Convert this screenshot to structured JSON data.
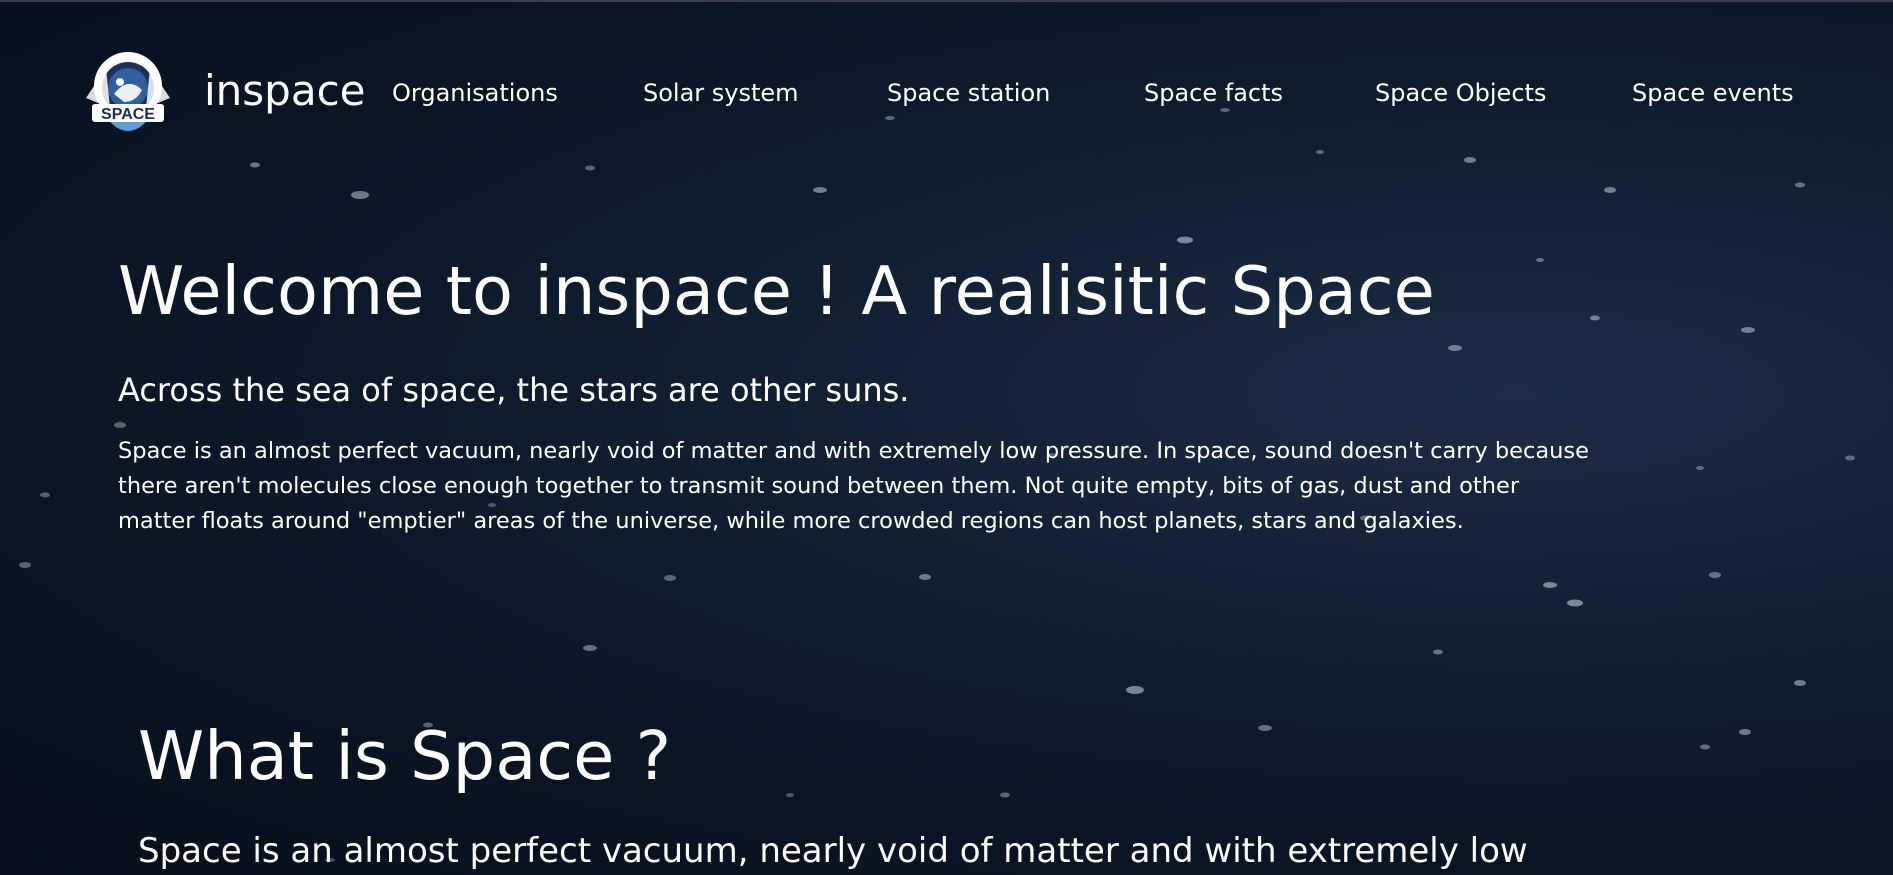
{
  "header": {
    "logo_text": "SPACE",
    "brand": "inspace",
    "nav": [
      {
        "label": "Organisations",
        "name": "nav-organisations"
      },
      {
        "label": "Solar system",
        "name": "nav-solar-system"
      },
      {
        "label": "Space station",
        "name": "nav-space-station"
      },
      {
        "label": "Space facts",
        "name": "nav-space-facts"
      },
      {
        "label": "Space Objects",
        "name": "nav-space-objects"
      },
      {
        "label": "Space events",
        "name": "nav-space-events"
      }
    ]
  },
  "hero": {
    "title": "Welcome to inspace ! A realisitic Space",
    "subtitle": "Across the sea of space, the stars are other suns.",
    "body": "Space is an almost perfect vacuum, nearly void of matter and with extremely low pressure. In space, sound doesn't carry because there aren't molecules close enough together to transmit sound between them. Not quite empty, bits of gas, dust and other matter floats around \"emptier\" areas of the universe, while more crowded regions can host planets, stars and galaxies."
  },
  "section": {
    "title": "What is Space ?",
    "body": "Space is an almost perfect vacuum, nearly void of matter and with extremely low"
  },
  "colors": {
    "background": "#0a1424",
    "text": "#ffffff",
    "logo_accent": "#5aa0d8"
  }
}
